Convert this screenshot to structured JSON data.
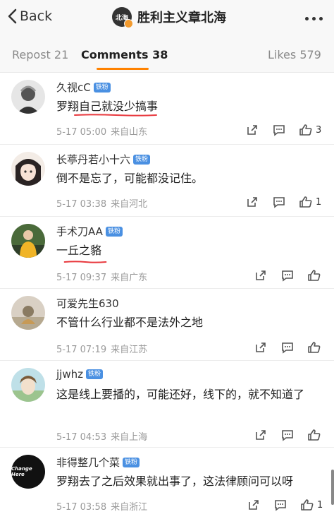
{
  "header": {
    "back_label": "Back",
    "title": "胜利主义章北海",
    "logo_text": "北海"
  },
  "tabs": [
    {
      "label": "Repost 21"
    },
    {
      "label": "Comments 38"
    },
    {
      "label": "Likes 579"
    }
  ],
  "fan_badge": "铁粉",
  "comments": [
    {
      "name": "久视cC",
      "text": "罗翔自己就没少搞事",
      "date": "5-17 05:00",
      "source": "来自山东",
      "likes": "3"
    },
    {
      "name": "长葶丹若小十六",
      "text": "倒不是忘了，可能都没记住。",
      "date": "5-17 03:38",
      "source": "来自河北",
      "likes": "1"
    },
    {
      "name": "手术刀AA",
      "text": "一丘之貉",
      "date": "5-17 09:37",
      "source": "来自广东",
      "likes": ""
    },
    {
      "name": "可爱先生630",
      "text": "不管什么行业都不是法外之地",
      "date": "5-17 07:19",
      "source": "来自江苏",
      "likes": ""
    },
    {
      "name": "jjwhz",
      "text": "这是线上要播的，可能还好，线下的，就不知道了",
      "date": "5-17 04:53",
      "source": "来自上海",
      "likes": ""
    },
    {
      "name": "非得整几个菜",
      "text": "罗翔去了之后效果就出事了，这法律顾问可以呀",
      "date": "5-17 03:58",
      "source": "来自浙江",
      "likes": "1"
    }
  ],
  "avatar6_text": "Change Here",
  "colors": {
    "accent": "#ff8200",
    "badge": "#4a90e2",
    "underline_red": "#e8383d"
  }
}
